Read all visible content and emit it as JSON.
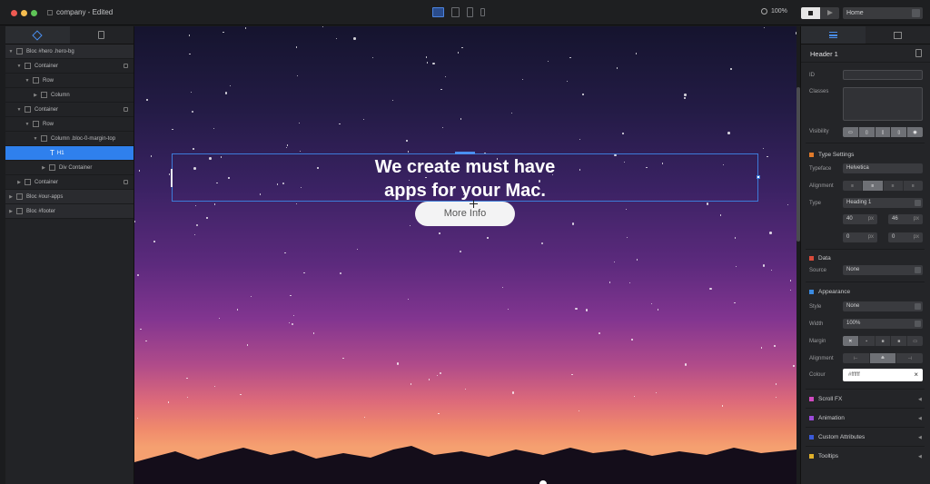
{
  "window": {
    "title": "company - Edited"
  },
  "toolbar": {
    "devices": [
      "desktop",
      "tablet-landscape",
      "tablet-portrait",
      "phone"
    ],
    "zoom": "100%",
    "page_select": "Home"
  },
  "layers": {
    "items": [
      {
        "label": "Bloc #hero .hero-bg",
        "depth": 0,
        "kind": "bloc",
        "expanded": true,
        "lock": false
      },
      {
        "label": "Container",
        "depth": 1,
        "kind": "node",
        "expanded": true,
        "lock": true
      },
      {
        "label": "Row",
        "depth": 2,
        "kind": "node",
        "expanded": true,
        "lock": false
      },
      {
        "label": "Column",
        "depth": 3,
        "kind": "node",
        "expanded": false,
        "lock": false
      },
      {
        "label": "Container",
        "depth": 1,
        "kind": "node",
        "expanded": true,
        "lock": true
      },
      {
        "label": "Row",
        "depth": 2,
        "kind": "node",
        "expanded": true,
        "lock": false
      },
      {
        "label": "Column .bloc-0-margin-top",
        "depth": 3,
        "kind": "node",
        "expanded": true,
        "lock": false
      },
      {
        "label": "H1",
        "depth": 4,
        "kind": "text",
        "selected": true,
        "lock": false
      },
      {
        "label": "Div Container",
        "depth": 4,
        "kind": "node",
        "expanded": false,
        "lock": false
      },
      {
        "label": "Container",
        "depth": 1,
        "kind": "node",
        "expanded": false,
        "lock": true
      },
      {
        "label": "Bloc #our-apps",
        "depth": 0,
        "kind": "bloc",
        "expanded": false,
        "lock": false
      },
      {
        "label": "Bloc #footer",
        "depth": 0,
        "kind": "bloc",
        "expanded": false,
        "lock": false
      }
    ]
  },
  "canvas": {
    "hero_title_line1": "We create must have",
    "hero_title_line2": "apps for your Mac.",
    "button_label": "More Info"
  },
  "inspector": {
    "header": "Header 1",
    "id_label": "ID",
    "id_value": "",
    "classes_label": "Classes",
    "visibility_label": "Visibility",
    "type_settings": {
      "title": "Type Settings",
      "color": "#e07a2a",
      "typeface_label": "Typeface",
      "typeface": "Helvetica",
      "alignment_label": "Alignment",
      "alignment_selected": "center",
      "type_label": "Type",
      "type_value": "Heading 1",
      "font_size": "40",
      "font_size_unit": "px",
      "line_height": "46",
      "line_height_unit": "px",
      "letter_spacing": "0",
      "letter_spacing_unit": "px",
      "word_spacing": "0",
      "word_spacing_unit": "px"
    },
    "data": {
      "title": "Data",
      "color": "#d94a3a",
      "source_label": "Source",
      "source_value": "None"
    },
    "appearance": {
      "title": "Appearance",
      "color": "#3a8ae0",
      "style_label": "Style",
      "style_value": "None",
      "width_label": "Width",
      "width_value": "100%",
      "margin_label": "Margin",
      "alignment_label": "Alignment",
      "colour_label": "Colour",
      "colour_value": "#ffffff"
    },
    "collapsed": [
      {
        "label": "Scroll FX",
        "color": "#d04ac0"
      },
      {
        "label": "Animation",
        "color": "#9a4ad8"
      },
      {
        "label": "Custom Attributes",
        "color": "#3a5ad8"
      },
      {
        "label": "Tooltips",
        "color": "#e0b02a"
      }
    ]
  }
}
